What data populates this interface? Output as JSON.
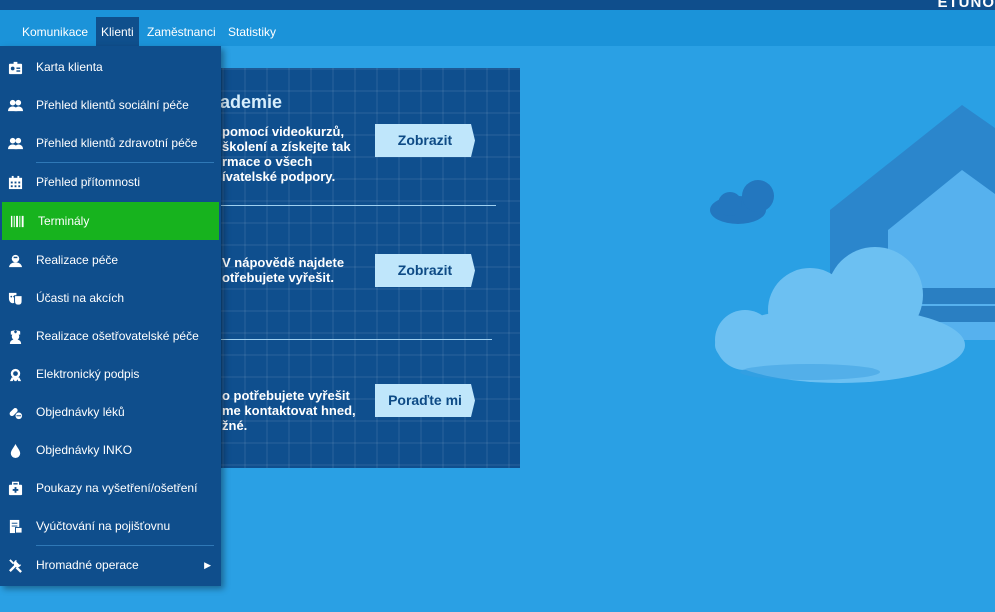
{
  "header": {
    "brand": "ETUNO"
  },
  "menu": {
    "tabs": [
      {
        "label": "Komunikace",
        "active": false
      },
      {
        "label": "Klienti",
        "active": true
      },
      {
        "label": "Zaměstnanci",
        "active": false
      },
      {
        "label": "Statistiky",
        "active": false
      }
    ]
  },
  "dropdown": {
    "items": [
      {
        "label": "Karta klienta",
        "icon": "client-card-icon"
      },
      {
        "label": "Přehled klientů sociální péče",
        "icon": "users-icon"
      },
      {
        "label": "Přehled klientů zdravotní péče",
        "icon": "users-icon"
      },
      {
        "label": "Přehled přítomnosti",
        "icon": "calendar-icon"
      },
      {
        "label": "Terminály",
        "icon": "barcode-icon",
        "active": true
      },
      {
        "label": "Realizace péče",
        "icon": "care-icon"
      },
      {
        "label": "Účasti na akcích",
        "icon": "theater-masks-icon"
      },
      {
        "label": "Realizace ošetřovatelské péče",
        "icon": "nurse-icon"
      },
      {
        "label": "Elektronický podpis",
        "icon": "signature-icon"
      },
      {
        "label": "Objednávky léků",
        "icon": "pills-icon"
      },
      {
        "label": "Objednávky INKO",
        "icon": "drop-icon"
      },
      {
        "label": "Poukazy na vyšetření/ošetření",
        "icon": "medkit-icon"
      },
      {
        "label": "Vyúčtování na pojišťovnu",
        "icon": "billing-icon"
      },
      {
        "label": "Hromadné operace",
        "icon": "tools-icon",
        "submenu": true
      }
    ]
  },
  "panel": {
    "title": "ademie",
    "section1": "pomocí videokurzů,\nškolení a získejte tak\nrmace o všech\nívatelské podpory.",
    "section2": "V nápovědě najdete\notřebujete vyřešit.",
    "section3": "o potřebujete vyřešit\nme kontaktovat hned,\nžné.",
    "button1": "Zobrazit",
    "button2": "Zobrazit",
    "button3": "Poraďte mi"
  },
  "colors": {
    "background": "#2aa0e4",
    "menu_bg": "#0f4e8c",
    "active_item": "#17b31e",
    "button_bg": "#bfe6fb"
  }
}
